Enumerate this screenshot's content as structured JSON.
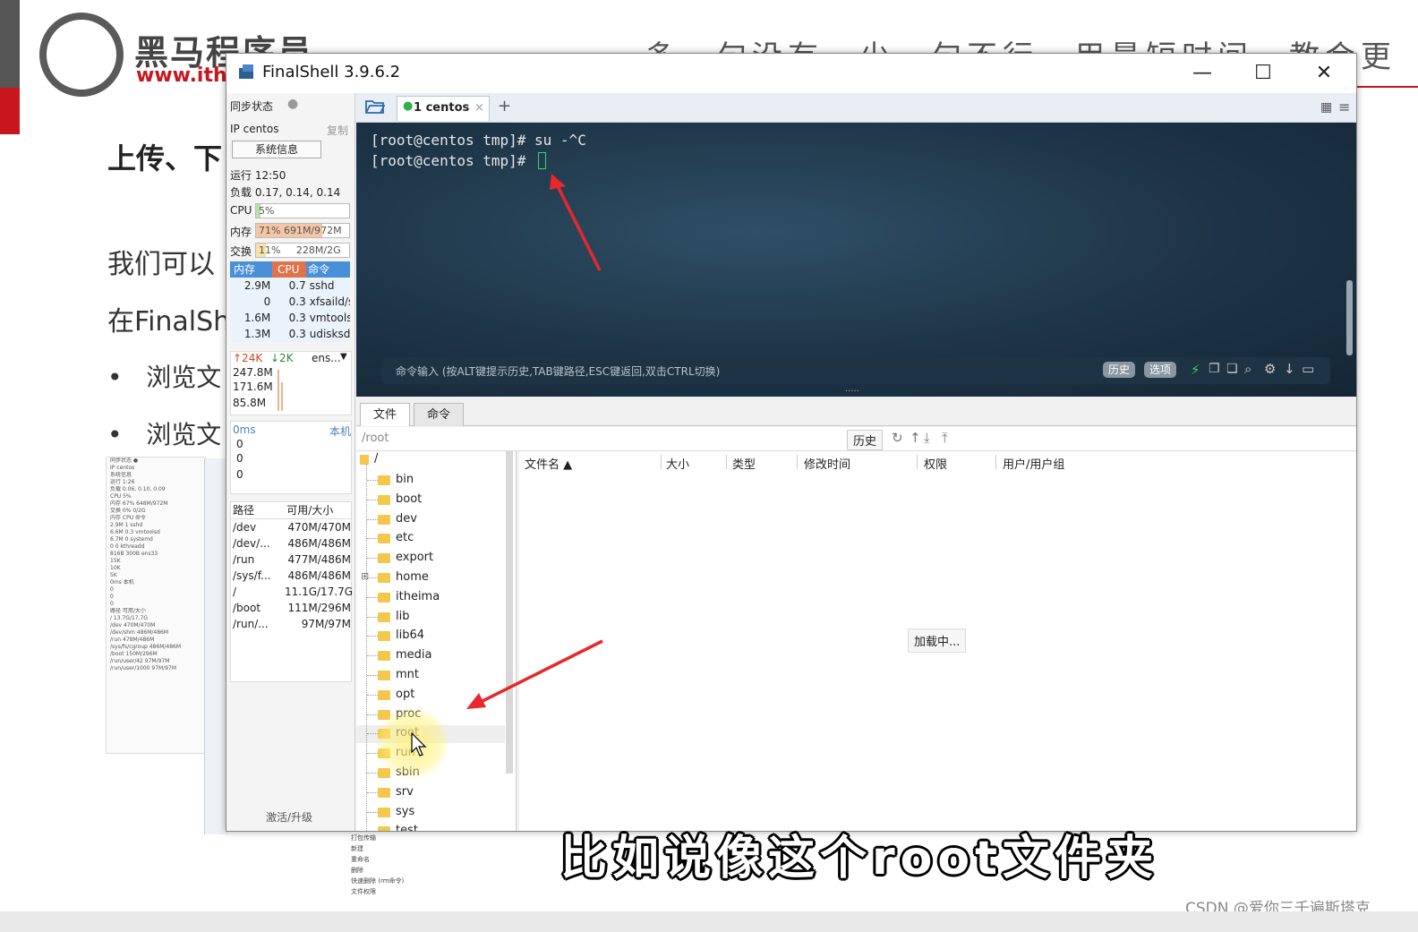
{
  "slide": {
    "logo_text": "黑马程序员",
    "logo_url": "www.ithe",
    "motto": "多一句没有，少一句不行，用最短时间，教会更",
    "heading": "上传、下",
    "para1": "我们可以",
    "para2": "在FinalSh",
    "bullet1": "浏览文",
    "bullet2": "浏览文"
  },
  "mini_shot": {
    "rows": [
      "同步状态 ●",
      "IP centos",
      "系统信息",
      "运行 1:26",
      "负载 0.06, 0.10, 0.09",
      "CPU 5%",
      "内存 67% 648M/972M",
      "交换 0% 0/2G",
      "内存 CPU 命令",
      "2.9M 1 sshd",
      "6.6M 0.3 vmtoolsd",
      "6.7M 0 systemd",
      "0 0 kthreadd",
      "816B 300B ens33",
      "15K",
      "10K",
      "5K",
      "0ms 本机",
      "0",
      "0",
      "0",
      "路径 可用/大小",
      "/ 13.7G/17.7G",
      "/dev 470M/470M",
      "/dev/shm 486M/486M",
      "/run 478M/486M",
      "/sys/fs/cgroup 486M/486M",
      "/boot 150M/296M",
      "/run/user/42 97M/97M",
      "/run/user/1000 97M/97M"
    ],
    "menu": [
      "打包传输",
      "新建",
      "重命名",
      "删除",
      "快速删除 (rm命令)",
      "文件权限"
    ]
  },
  "window": {
    "title": "FinalShell 3.9.6.2",
    "minimize": "—",
    "maximize": "☐",
    "close": "✕"
  },
  "left_panel": {
    "sync_label": "同步状态",
    "ip_label": "IP centos",
    "copy_label": "复制",
    "sysinfo_button": "系统信息",
    "uptime": "运行 12:50",
    "load": "负载 0.17, 0.14, 0.14",
    "cpu_label": "CPU",
    "cpu_value": "5%",
    "cpu_pct": 5,
    "mem_label": "内存",
    "mem_value": "71% 691M/972M",
    "mem_pct": 71,
    "swap_label": "交换",
    "swap_value": "11%     228M/2G",
    "swap_pct": 11,
    "proc_headers": [
      "内存",
      "CPU",
      "命令"
    ],
    "procs": [
      {
        "mem": "2.9M",
        "cpu": "0.7",
        "cmd": "sshd"
      },
      {
        "mem": "0",
        "cpu": "0.3",
        "cmd": "xfsaild/s"
      },
      {
        "mem": "1.6M",
        "cpu": "0.3",
        "cmd": "vmtoolsd"
      },
      {
        "mem": "1.3M",
        "cpu": "0.3",
        "cmd": "udisksd"
      }
    ],
    "net_up": "↑24K",
    "net_down": "↓2K",
    "net_iface": "ens...",
    "net_scale": [
      "247.8M",
      "171.6M",
      "85.8M"
    ],
    "ping_ms": "0ms",
    "ping_host": "本机",
    "ping_values": [
      "0",
      "0",
      "0"
    ],
    "disk_headers": [
      "路径",
      "可用/大小"
    ],
    "disks": [
      {
        "path": "/dev",
        "size": "470M/470M"
      },
      {
        "path": "/dev/...",
        "size": "486M/486M"
      },
      {
        "path": "/run",
        "size": "477M/486M"
      },
      {
        "path": "/sys/f...",
        "size": "486M/486M"
      },
      {
        "path": "/",
        "size": "11.1G/17.7G"
      },
      {
        "path": "/boot",
        "size": "111M/296M"
      },
      {
        "path": "/run/...",
        "size": "97M/97M"
      }
    ],
    "activate": "激活/升级"
  },
  "tabs": {
    "session_tab": "1 centos",
    "close_tab": "×",
    "add_tab": "+"
  },
  "terminal": {
    "lines": [
      "[root@centos tmp]# su -^C",
      "[root@centos tmp]# "
    ],
    "cmd_hint": "命令输入 (按ALT键提示历史,TAB键路径,ESC键返回,双击CTRL切换)",
    "history_btn": "历史",
    "options_btn": "选项",
    "splitter": "....."
  },
  "files": {
    "tab_files": "文件",
    "tab_commands": "命令",
    "path": "/root",
    "history_btn": "历史",
    "tree_root": "/",
    "tree": [
      "bin",
      "boot",
      "dev",
      "etc",
      "export",
      "home",
      "itheima",
      "lib",
      "lib64",
      "media",
      "mnt",
      "opt",
      "proc",
      "root",
      "run",
      "sbin",
      "srv",
      "sys",
      "test"
    ],
    "columns": [
      "文件名 ▲",
      "大小",
      "类型",
      "修改时间",
      "权限",
      "用户/用户组"
    ],
    "loading": "加载中..."
  },
  "subtitle": "比如说像这个root文件夹",
  "watermark": "CSDN @爱你三千遍斯塔克",
  "colors": {
    "accent_red": "#c8161e",
    "terminal_bg": "#1d3447",
    "mem_header": "#4a90d9",
    "cpu_header": "#e0734a",
    "arrow": "#e8282a",
    "session_dot": "#2bb24c"
  }
}
